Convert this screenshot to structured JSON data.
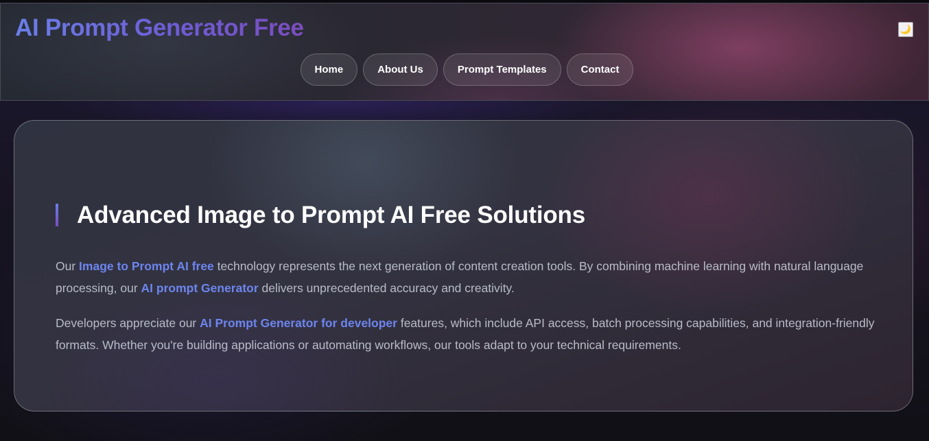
{
  "header": {
    "logo_text": "AI Prompt Generator Free",
    "theme_toggle_icon": "🌙",
    "nav": [
      {
        "label": "Home"
      },
      {
        "label": "About Us"
      },
      {
        "label": "Prompt Templates"
      },
      {
        "label": "Contact"
      }
    ]
  },
  "section": {
    "heading": "Advanced Image to Prompt AI Free Solutions",
    "paragraph1": {
      "t1": "Our ",
      "link1": "Image to Prompt AI free",
      "t2": " technology represents the next generation of content creation tools. By combining machine learning with natural language processing, our ",
      "link2": "AI prompt Generator",
      "t3": " delivers unprecedented accuracy and creativity."
    },
    "paragraph2": {
      "t1": "Developers appreciate our ",
      "link1": "AI Prompt Generator for developer",
      "t2": " features, which include API access, batch processing capabilities, and integration-friendly formats. Whether you're building applications or automating workflows, our tools adapt to your technical requirements."
    }
  },
  "colors": {
    "accent_link": "#6d85ee",
    "logo_gradient_start": "#6a7fe8",
    "logo_gradient_end": "#7b4dbd",
    "heading": "#ffffff",
    "body_text": "#b9bcc8"
  }
}
